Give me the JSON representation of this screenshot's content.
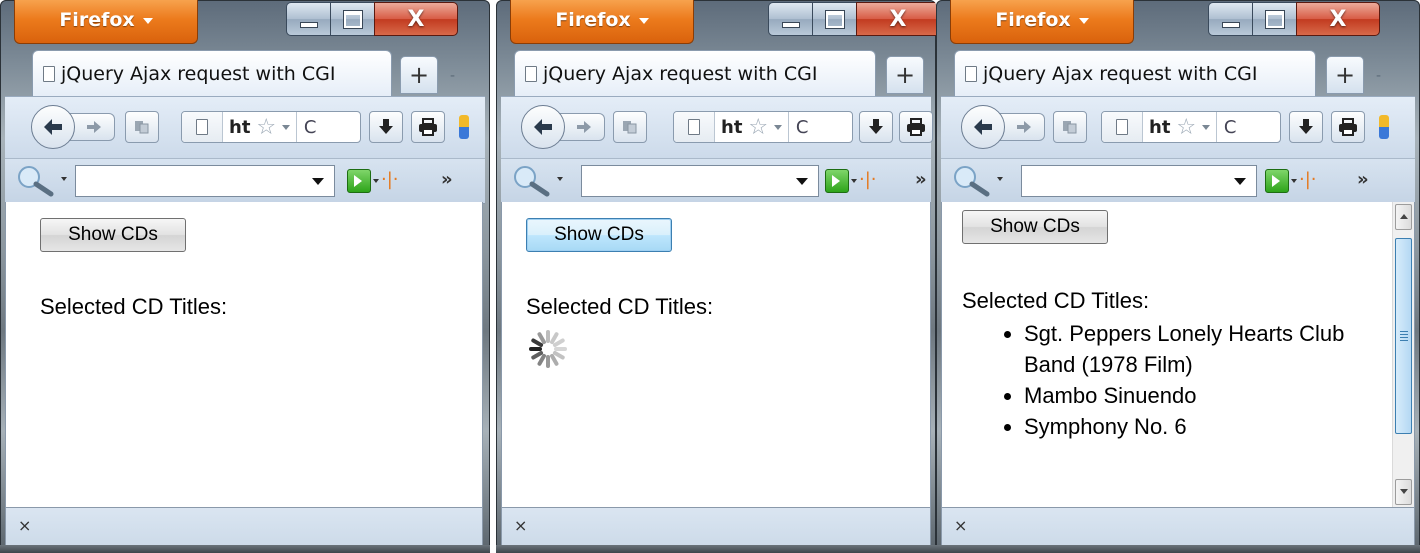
{
  "windows": [
    {
      "menu_label": "Firefox",
      "tab_title": "jQuery Ajax request with CGI",
      "url": "ht",
      "close_glyph": "X",
      "new_tab_glyph": "+",
      "overflow_glyph": "»",
      "button_label": "Show CDs",
      "heading": "Selected CD Titles:",
      "status_close": "×"
    },
    {
      "menu_label": "Firefox",
      "tab_title": "jQuery Ajax request with CGI",
      "url": "ht",
      "close_glyph": "X",
      "new_tab_glyph": "+",
      "overflow_glyph": "»",
      "button_label": "Show CDs",
      "heading": "Selected CD Titles:",
      "status_close": "×"
    },
    {
      "menu_label": "Firefox",
      "tab_title": "jQuery Ajax request with CGI",
      "url": "ht",
      "close_glyph": "X",
      "new_tab_glyph": "+",
      "overflow_glyph": "»",
      "button_label": "Show CDs",
      "heading": "Selected CD Titles:",
      "status_close": "×",
      "cd_titles": [
        "Sgt. Peppers Lonely Hearts Club Band (1978 Film)",
        "Mambo Sinuendo",
        "Symphony No. 6"
      ]
    }
  ],
  "icons": [
    "firefox-menu-caret-icon",
    "minimize-icon",
    "maximize-icon",
    "close-icon",
    "page-icon",
    "back-arrow-icon",
    "forward-arrow-icon",
    "reading-icon",
    "bookmark-star-icon",
    "reload-icon",
    "download-icon",
    "print-icon",
    "search-magnifier-icon",
    "go-arrow-icon",
    "loading-spinner-icon"
  ],
  "colors": {
    "firefox_button": "#ec7a1c",
    "close_button": "#c23b20",
    "toolbar": "#ccdaea",
    "focus_blue": "#3c7fb1"
  }
}
